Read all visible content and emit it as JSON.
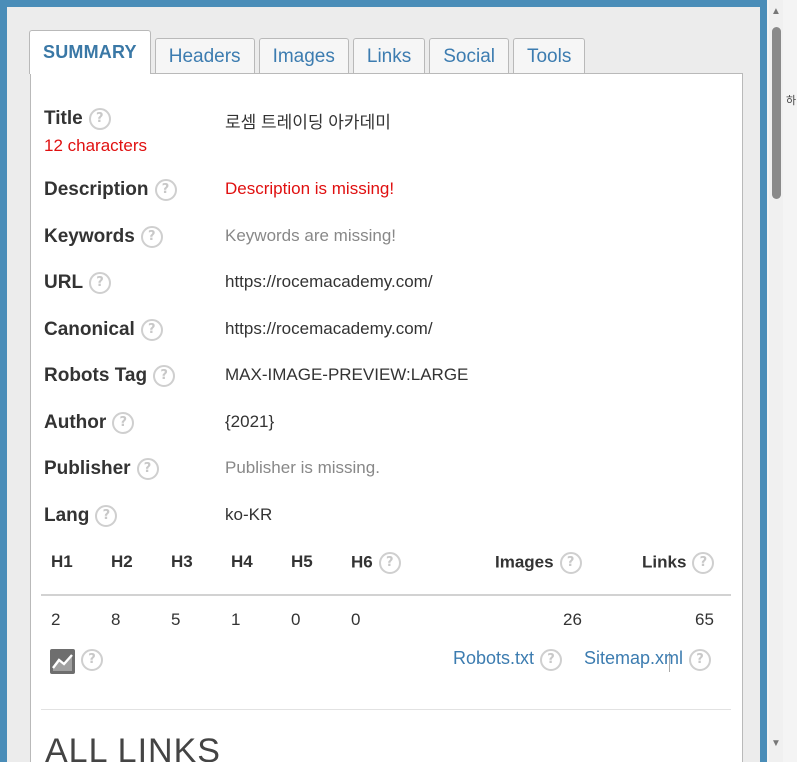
{
  "tabs": [
    {
      "label": "SUMMARY"
    },
    {
      "label": "Headers"
    },
    {
      "label": "Images"
    },
    {
      "label": "Links"
    },
    {
      "label": "Social"
    },
    {
      "label": "Tools"
    }
  ],
  "summary": {
    "title": {
      "label": "Title",
      "value": "로셈 트레이딩 아카데미",
      "count": "12 characters"
    },
    "description": {
      "label": "Description",
      "value": "Description is missing!"
    },
    "keywords": {
      "label": "Keywords",
      "value": "Keywords are missing!"
    },
    "url": {
      "label": "URL",
      "value": "https://rocemacademy.com/"
    },
    "canonical": {
      "label": "Canonical",
      "value": "https://rocemacademy.com/"
    },
    "robots_tag": {
      "label": "Robots Tag",
      "value": "MAX-IMAGE-PREVIEW:LARGE"
    },
    "author": {
      "label": "Author",
      "value": "{2021}"
    },
    "publisher": {
      "label": "Publisher",
      "value": "Publisher is missing."
    },
    "lang": {
      "label": "Lang",
      "value": "ko-KR"
    }
  },
  "headings": {
    "columns": [
      "H1",
      "H2",
      "H3",
      "H4",
      "H5",
      "H6"
    ],
    "values": [
      "2",
      "8",
      "5",
      "1",
      "0",
      "0"
    ],
    "images_label": "Images",
    "images_value": "26",
    "links_label": "Links",
    "links_value": "65"
  },
  "footer": {
    "robots_link": "Robots.txt",
    "sitemap_link": "Sitemap.xml"
  },
  "all_links_heading": "ALL LINKS",
  "help_glyph": "?",
  "colors": {
    "frame": "#4a8db8",
    "tab_text": "#3c7cb0",
    "error": "#e01010",
    "muted": "#888888"
  },
  "background": {
    "side_char": "하"
  }
}
